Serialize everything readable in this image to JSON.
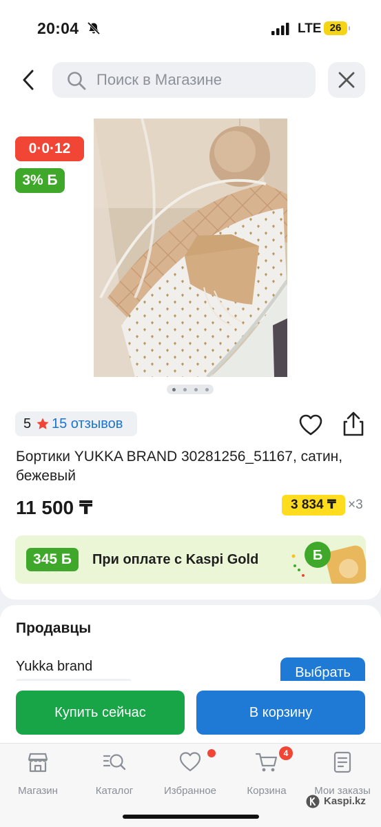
{
  "status_bar": {
    "time": "20:04",
    "network": "LTE",
    "battery": "26"
  },
  "header": {
    "search_placeholder": "Поиск в Магазине"
  },
  "product": {
    "timer_badge": "0·0·12",
    "bonus_badge": "3% Б",
    "rating": "5",
    "reviews_label": "15 отзывов",
    "title": "Бортики YUKKA BRAND 30281256_51167, сатин, бежевый",
    "price": "11 500 ₸",
    "installment_price": "3 834 ₸",
    "installment_multiplier": "×3",
    "carousel_total": 4,
    "carousel_active": 1
  },
  "gold_banner": {
    "bonus": "345 Б",
    "text": "При оплате с Kaspi Gold"
  },
  "sellers": {
    "title": "Продавцы",
    "items": [
      {
        "name": "Yukka brand",
        "action": "Выбрать"
      }
    ]
  },
  "actions": {
    "buy_now": "Купить сейчас",
    "add_to_cart": "В корзину"
  },
  "bottom_nav": {
    "items": [
      {
        "label": "Магазин",
        "icon": "shop-icon"
      },
      {
        "label": "Каталог",
        "icon": "catalog-icon"
      },
      {
        "label": "Избранное",
        "icon": "heart-icon"
      },
      {
        "label": "Корзина",
        "icon": "cart-icon"
      },
      {
        "label": "Мои заказы",
        "icon": "orders-icon"
      }
    ],
    "cart_count": "4"
  },
  "watermark": "Kaspi.kz",
  "colors": {
    "accent_blue": "#1e7ad4",
    "buy_green": "#17a548",
    "bonus_green": "#3fa82a",
    "alert_red": "#f14635",
    "installment_yellow": "#ffdc1e"
  }
}
